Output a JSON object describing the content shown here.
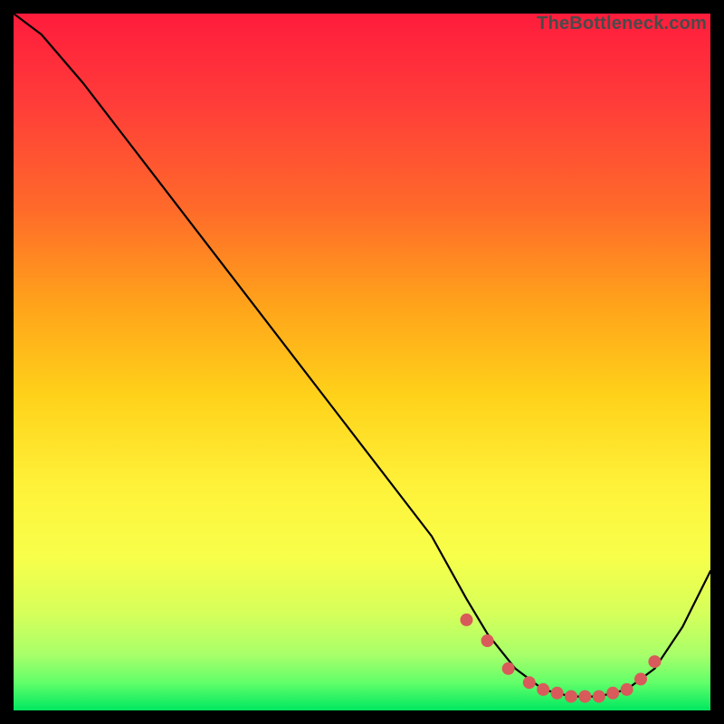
{
  "watermark": "TheBottleneck.com",
  "chart_data": {
    "type": "line",
    "title": "",
    "xlabel": "",
    "ylabel": "",
    "xlim": [
      0,
      100
    ],
    "ylim": [
      0,
      100
    ],
    "series": [
      {
        "name": "curve",
        "x": [
          0,
          4,
          10,
          20,
          30,
          40,
          50,
          60,
          65,
          68,
          72,
          76,
          80,
          84,
          88,
          92,
          96,
          100
        ],
        "y": [
          100,
          97,
          90,
          77,
          64,
          51,
          38,
          25,
          16,
          11,
          6,
          3,
          2,
          2,
          3,
          6,
          12,
          20
        ]
      }
    ],
    "markers": {
      "name": "dots",
      "x": [
        65,
        68,
        71,
        74,
        76,
        78,
        80,
        82,
        84,
        86,
        88,
        90,
        92
      ],
      "y": [
        13,
        10,
        6,
        4,
        3,
        2.5,
        2,
        2,
        2,
        2.5,
        3,
        4.5,
        7
      ]
    },
    "colors": {
      "curve": "#000000",
      "markers": "#d95a5a"
    }
  }
}
